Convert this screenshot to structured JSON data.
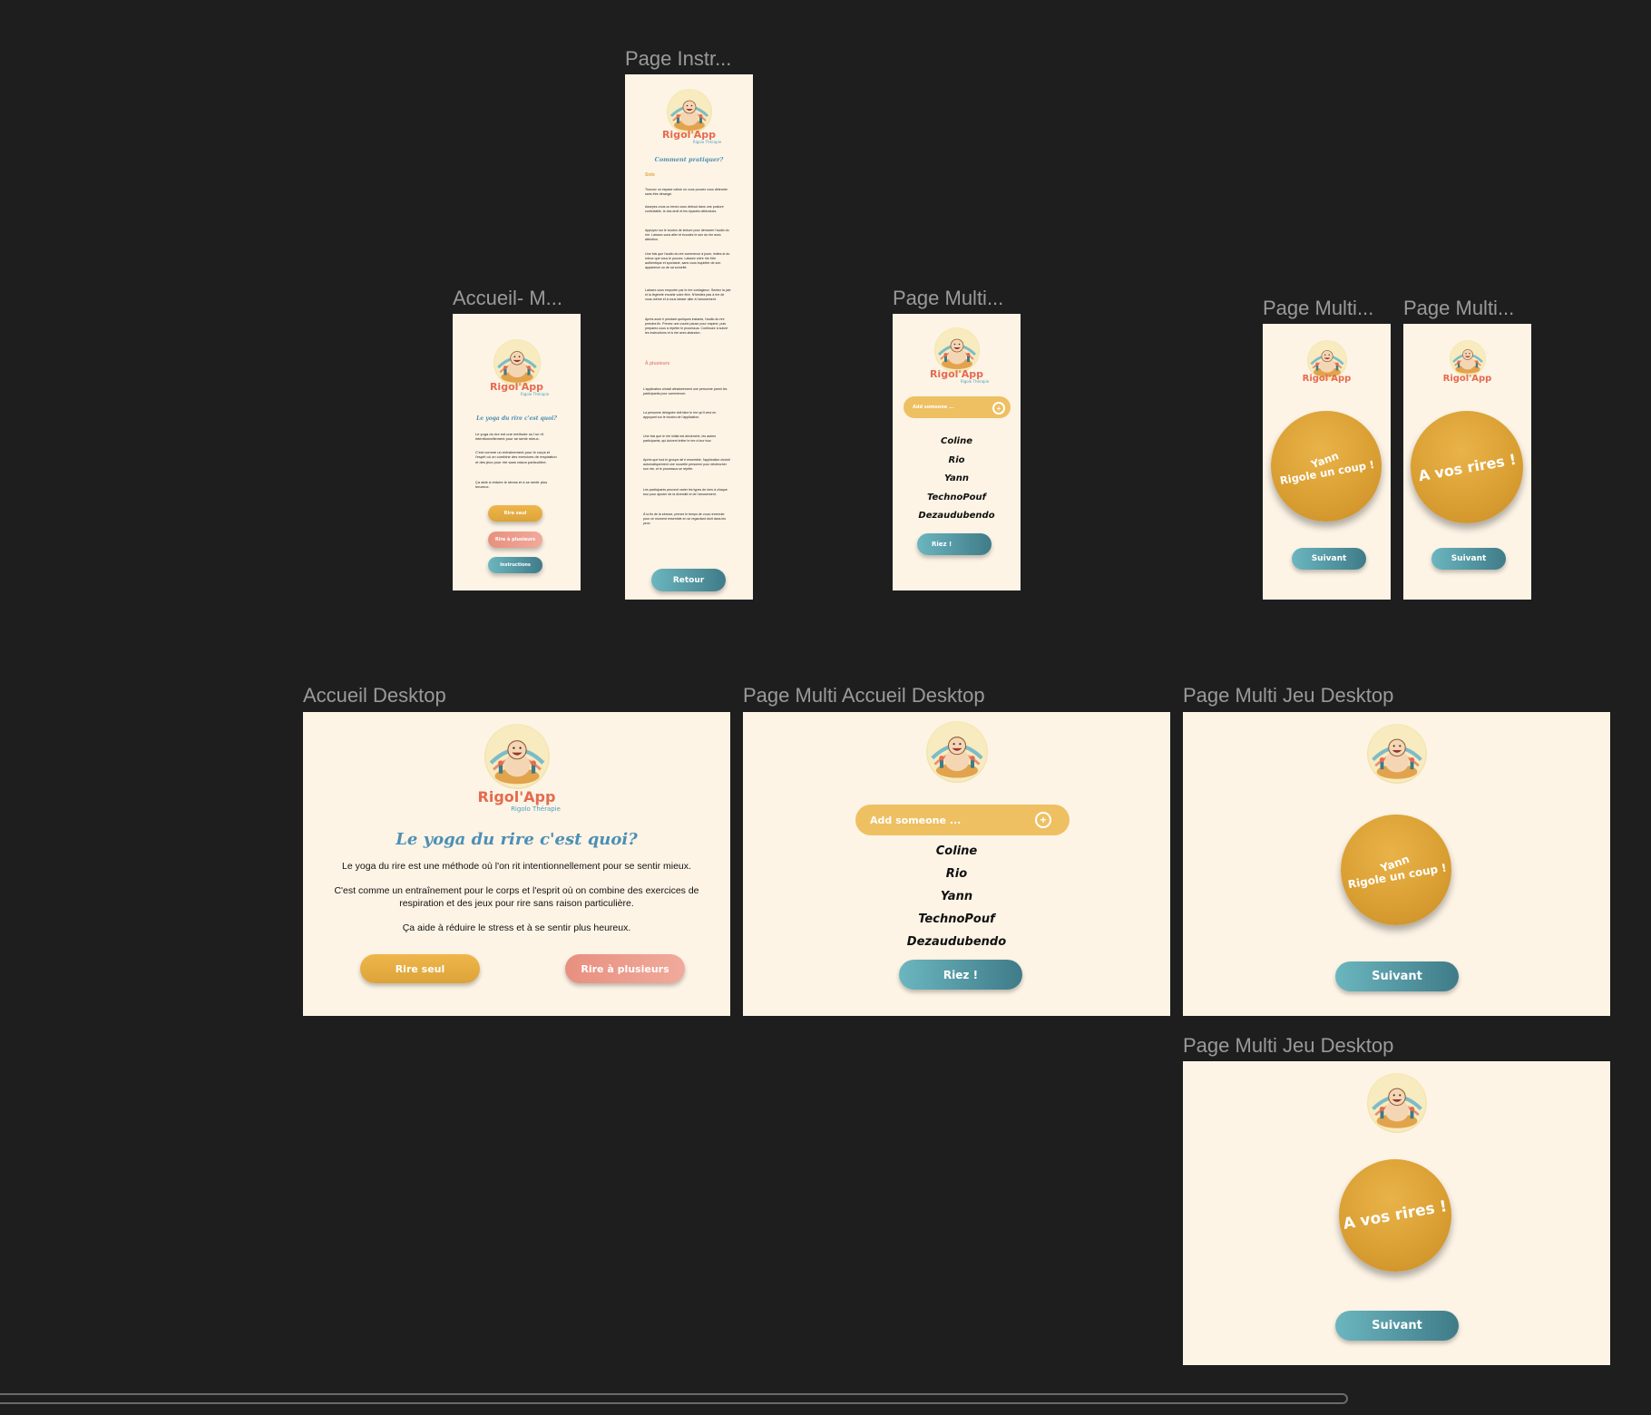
{
  "canvas": {
    "frames": {
      "accueil_mobile": {
        "title": "Accueil- M...",
        "brand": "Rigol'App",
        "subtitle": "Rigolo Thérapie",
        "heading": "Le yoga du rire c'est quoi?",
        "paragraphs": [
          "Le yoga du rire est une méthode où l'on rit intentionnellement pour se sentir mieux.",
          "C'est comme un entraînement pour le corps et l'esprit où on combine des exercices de respiration et des jeux pour rire sans raison particulière.",
          "Ça aide à réduire le stress et à se sentir plus heureux."
        ],
        "buttons": {
          "solo": "Rire seul",
          "multi": "Rire à plusieurs",
          "instructions": "Instructions"
        }
      },
      "instructions_mobile": {
        "title": "Page Instr...",
        "brand": "Rigol'App",
        "subtitle": "Rigolo Thérapie",
        "heading": "Comment pratiquer?",
        "solo_label": "Solo",
        "multi_label": "À plusieurs",
        "solo_paragraphs": [
          "Trouvez un espace calme où vous pouvez vous détendre sans être dérangé.",
          "Asseyez-vous ou tenez-vous debout dans une posture confortable, le dos droit et les épaules détendues.",
          "Appuyez sur le bouton de lecture pour démarrer l'audio du rire. Laissez-vous aller et écoutez le son du rire avec attention.",
          "Une fois que l'audio du rire commence à jouer, imitez-le du mieux que vous le pouvez. Laissez votre rire être authentique et spontané, sans vous inquiéter de son apparence ou de sa sonorité.",
          "Laissez-vous emporter par le rire contagieux. Sentez la joie et la légèreté envahir votre être. N'hésitez pas à rire de vous-même et à vous laisser aller à l'amusement.",
          "Après avoir ri pendant quelques instants, l'audio du rire prendra fin. Prenez une courte pause pour respirer, puis preparez-vous à répéter le processus. Continuez à suivre les instructions et à rire avec abandon."
        ],
        "multi_paragraphs": [
          "L'application choisit aléatoirement une personne parmi les participants pour commencer.",
          "La personne désignée doit faire le rire qu'il veut en appuyant sur le bouton de l'application.",
          "Une fois que le rire initial est déclenché, les autres participants, qui doivent imiter le rire à leur tour.",
          "Après que tout le groupe ait ri ensemble, l'application choisit automatiquement une nouvelle personne pour déclencher son rire, et le processus se répète.",
          "Les participants peuvent varier les types de rires à chaque tour pour ajouter de la diversité et de l'amusement.",
          "À la fin de la séance, prenez le temps de vous remercier pour ce moment ensemble en se regardant droit dans les yeux"
        ],
        "back_button": "Retour"
      },
      "multi_mobile": {
        "title": "Page Multi...",
        "brand": "Rigol'App",
        "subtitle": "Rigolo Thérapie",
        "add_placeholder": "Add someone ...",
        "players": [
          "Coline",
          "Rio",
          "Yann",
          "TechnoPouf",
          "Dezaudubendo"
        ],
        "laugh_button": "Riez !"
      },
      "multi_game_mobile_1": {
        "title": "Page Multi...",
        "brand": "Rigol'App",
        "circle_name": "Yann",
        "circle_text": "Rigole un coup !",
        "next_button": "Suivant"
      },
      "multi_game_mobile_2": {
        "title": "Page Multi...",
        "brand": "Rigol'App",
        "circle_text": "A vos rires !",
        "next_button": "Suivant"
      },
      "accueil_desktop": {
        "title": "Accueil Desktop",
        "brand": "Rigol'App",
        "subtitle": "Rigolo Thérapie",
        "heading": "Le yoga du rire c'est quoi?",
        "paragraph1": "Le yoga du rire est une méthode où l'on rit intentionnellement pour se sentir mieux.",
        "paragraph2": "C'est comme un entraînement pour le corps et l'esprit où on combine des exercices de respiration et des jeux pour rire sans raison particulière.",
        "paragraph3": "Ça aide à réduire le stress et à se sentir plus heureux.",
        "buttons": {
          "solo": "Rire seul",
          "multi": "Rire à plusieurs"
        }
      },
      "multi_accueil_desktop": {
        "title": "Page Multi Accueil Desktop",
        "add_placeholder": "Add someone ...",
        "players": [
          "Coline",
          "Rio",
          "Yann",
          "TechnoPouf",
          "Dezaudubendo"
        ],
        "laugh_button": "Riez !"
      },
      "multi_jeu_desktop_1": {
        "title": "Page Multi Jeu Desktop",
        "circle_name": "Yann",
        "circle_text": "Rigole un coup !",
        "next_button": "Suivant"
      },
      "multi_jeu_desktop_2": {
        "title": "Page Multi Jeu Desktop",
        "circle_text": "A vos rires !",
        "next_button": "Suivant"
      }
    }
  },
  "colors": {
    "canvas": "#1e1e1e",
    "frame_bg": "#fdf4e6",
    "gold": "#e0a63c",
    "coral": "#ec9c8c",
    "teal": "#4f95a0",
    "brand": "#e56b4e",
    "heading": "#4c8fb4"
  },
  "icons": {
    "logo": "laughing-buddha-logo",
    "add": "plus-circle-icon"
  }
}
